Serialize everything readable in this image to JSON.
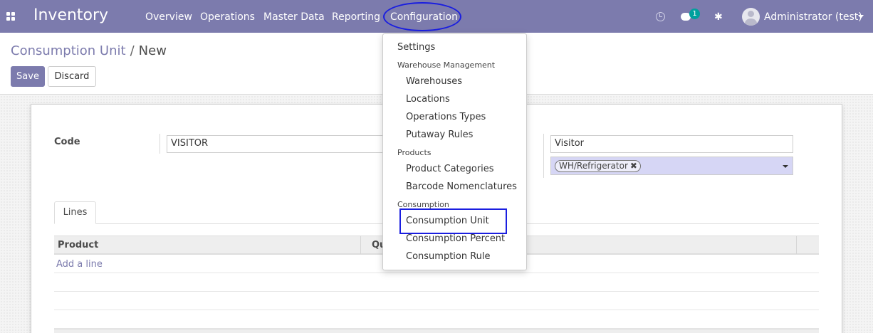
{
  "navbar": {
    "app_name": "Inventory",
    "menu": [
      "Overview",
      "Operations",
      "Master Data",
      "Reporting",
      "Configuration"
    ],
    "active_menu": "Configuration",
    "chat_badge": "1",
    "user": "Administrator (test)"
  },
  "breadcrumb": {
    "parent": "Consumption Unit",
    "separator": "/",
    "current": "New"
  },
  "buttons": {
    "save": "Save",
    "discard": "Discard"
  },
  "form": {
    "code_label": "Code",
    "code_value": "VISITOR",
    "name_value": "Visitor",
    "location_tag": "WH/Refrigerator",
    "tag_remove": "✖"
  },
  "tabs": {
    "lines": "Lines"
  },
  "table": {
    "columns": [
      "Product",
      "Qu"
    ],
    "add_line": "Add a line"
  },
  "config_menu": {
    "settings": "Settings",
    "groups": [
      {
        "header": "Warehouse Management",
        "items": [
          "Warehouses",
          "Locations",
          "Operations Types",
          "Putaway Rules"
        ]
      },
      {
        "header": "Products",
        "items": [
          "Product Categories",
          "Barcode Nomenclatures"
        ]
      },
      {
        "header": "Consumption",
        "items": [
          "Consumption Unit",
          "Consumption Percent",
          "Consumption Rule"
        ]
      }
    ]
  },
  "colors": {
    "brand": "#7c7bad",
    "annotation": "#1a1ee0",
    "badge": "#00a09d",
    "tag_field": "#d6d6f5"
  },
  "icons": [
    "apps-grid-icon",
    "clock-icon",
    "chat-icon",
    "bug-icon",
    "avatar-icon",
    "caret-down-icon"
  ]
}
